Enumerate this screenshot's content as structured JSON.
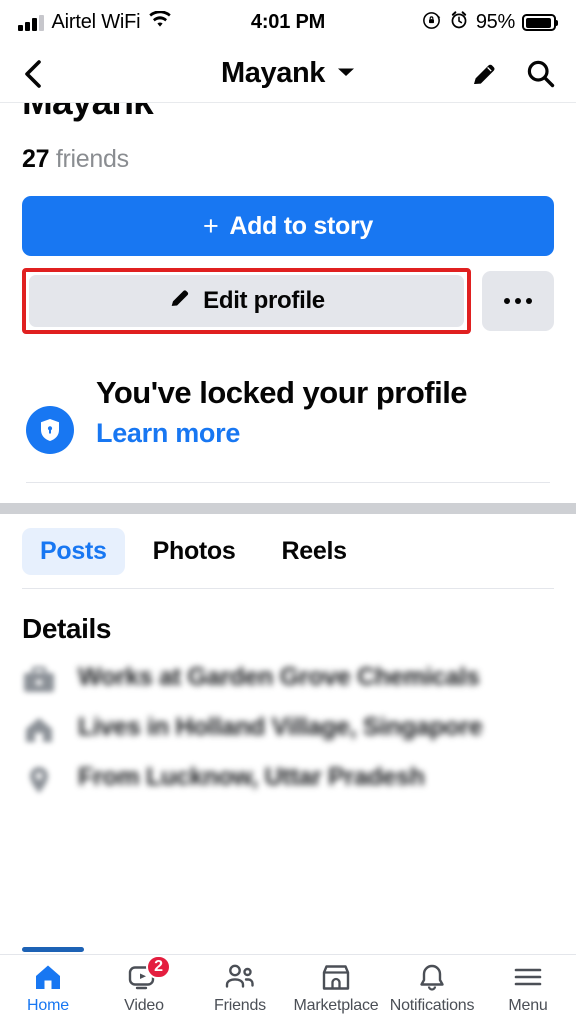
{
  "status_bar": {
    "carrier": "Airtel WiFi",
    "time": "4:01 PM",
    "battery_percent": "95%",
    "signal_icon": "signal-bars-icon",
    "wifi_icon": "wifi-icon",
    "rotation_lock_icon": "rotation-lock-icon",
    "alarm_icon": "alarm-clock-icon",
    "battery_icon": "battery-icon"
  },
  "header": {
    "back_icon": "back-chevron-icon",
    "title": "Mayank",
    "dropdown_icon": "chevron-down-icon",
    "edit_icon": "pencil-icon",
    "search_icon": "search-icon"
  },
  "profile": {
    "name": "Mayank",
    "friends_count": "27",
    "friends_label": "friends",
    "add_story_label": "Add to story",
    "add_story_plus": "+",
    "edit_profile_label": "Edit profile",
    "edit_profile_icon": "pencil-icon",
    "more_options_icon": "ellipsis-icon"
  },
  "locked_notice": {
    "shield_icon": "shield-lock-icon",
    "title": "You've locked your profile",
    "link_label": "Learn more"
  },
  "tabs": [
    {
      "label": "Posts",
      "active": true
    },
    {
      "label": "Photos",
      "active": false
    },
    {
      "label": "Reels",
      "active": false
    }
  ],
  "details": {
    "heading": "Details",
    "rows": [
      {
        "icon": "briefcase-icon",
        "text": "Works at Garden Grove Chemicals",
        "blurred": true
      },
      {
        "icon": "home-icon",
        "text": "Lives in Holland Village, Singapore",
        "blurred": true
      },
      {
        "icon": "location-pin-icon",
        "text": "From Lucknow, Uttar Pradesh",
        "blurred": true
      }
    ]
  },
  "bottom_nav": [
    {
      "label": "Home",
      "icon": "home-icon",
      "active": true,
      "badge": ""
    },
    {
      "label": "Video",
      "icon": "video-icon",
      "active": false,
      "badge": "2"
    },
    {
      "label": "Friends",
      "icon": "friends-icon",
      "active": false,
      "badge": ""
    },
    {
      "label": "Marketplace",
      "icon": "marketplace-icon",
      "active": false,
      "badge": ""
    },
    {
      "label": "Notifications",
      "icon": "bell-icon",
      "active": false,
      "badge": ""
    },
    {
      "label": "Menu",
      "icon": "hamburger-menu-icon",
      "active": false,
      "badge": ""
    }
  ],
  "colors": {
    "brand_blue": "#1877f2",
    "button_gray": "#e4e6eb",
    "highlight_red": "#e02020",
    "badge_red": "#e41e3f",
    "text_primary": "#050505",
    "text_secondary": "#8a8d91"
  }
}
